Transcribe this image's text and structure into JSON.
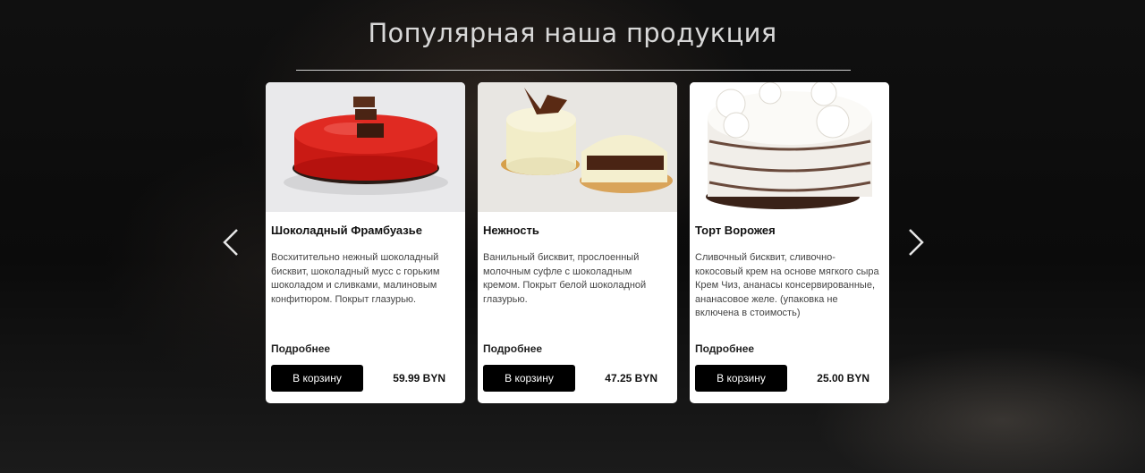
{
  "section": {
    "title": "Популярная наша продукция"
  },
  "carousel": {
    "prev_icon": "chevron-left-icon",
    "next_icon": "chevron-right-icon"
  },
  "products": [
    {
      "name": "Шоколадный Фрамбуазье",
      "description": "Восхитительно нежный шоколадный бисквит, шоколадный мусс с горьким шоколадом и сливками, малиновым конфитюром. Покрыт глазурью.",
      "more_label": "Подробнее",
      "cart_label": "В корзину",
      "price": "59.99 BYN"
    },
    {
      "name": "Нежность",
      "description": "Ванильный бисквит, прослоенный молочным суфле с шоколадным кремом. Покрыт белой шоколадной глазурью.",
      "more_label": "Подробнее",
      "cart_label": "В корзину",
      "price": "47.25 BYN"
    },
    {
      "name": "Торт Ворожея",
      "description": "Сливочный бисквит, сливочно-кокосовый крем на основе мягкого сыра Крем Чиз, ананасы консервированные, ананасовое желе. (упаковка не включена в стоимость)",
      "more_label": "Подробнее",
      "cart_label": "В корзину",
      "price": "25.00 BYN"
    }
  ],
  "colors": {
    "button_bg": "#000000",
    "card_bg": "#ffffff",
    "heading": "#d8d8d8"
  }
}
